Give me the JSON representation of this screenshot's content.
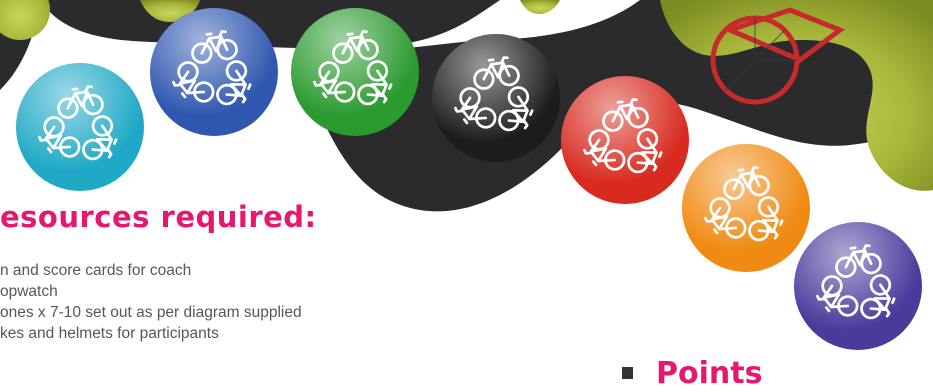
{
  "colors": {
    "accent": "#e5176f",
    "body_text": "#55575b",
    "dark_shape": "#2b2b2d",
    "bike_icon": "#ffffff"
  },
  "section_heading": "esources required:",
  "resources": [
    "n and score cards for coach",
    "opwatch",
    "ones x 7-10 set out as per diagram supplied",
    "kes and helmets for participants"
  ],
  "points_heading": "Points",
  "badges": [
    {
      "icon": "recycle-bicycle-icon",
      "color": "turquoise",
      "hex": "#1fa9c6"
    },
    {
      "icon": "recycle-bicycle-icon",
      "color": "blue",
      "hex": "#2f57b0"
    },
    {
      "icon": "recycle-bicycle-icon",
      "color": "green",
      "hex": "#2b9a2f"
    },
    {
      "icon": "recycle-bicycle-icon",
      "color": "black",
      "hex": "#1c1c1c"
    },
    {
      "icon": "recycle-bicycle-icon",
      "color": "red",
      "hex": "#d82a1e"
    },
    {
      "icon": "recycle-bicycle-icon",
      "color": "orange",
      "hex": "#f08a12"
    },
    {
      "icon": "recycle-bicycle-icon",
      "color": "purple",
      "hex": "#4a3a9c"
    }
  ]
}
